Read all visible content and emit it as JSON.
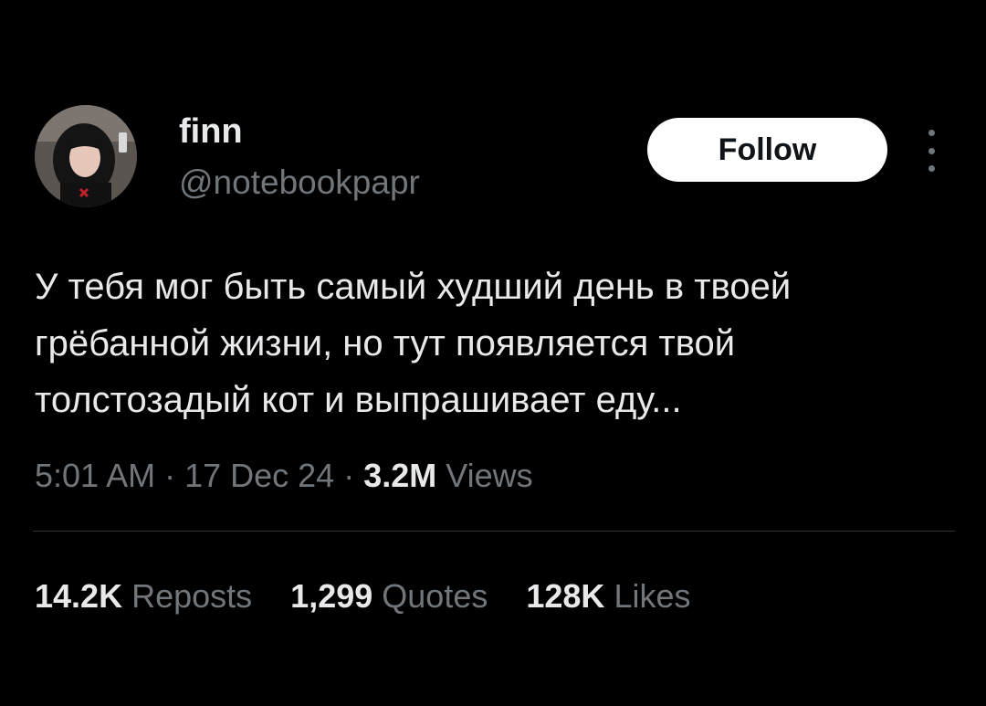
{
  "user": {
    "display_name": "finn",
    "handle": "@notebookpapr",
    "avatar": "profile-photo"
  },
  "follow_button": {
    "label": "Follow"
  },
  "more_menu": {
    "icon": "more-vertical-icon"
  },
  "tweet": {
    "lines": [
      "У тебя мог быть самый худший день в твоей",
      "грёбанной жизни, но тут появляется твой",
      "толстозадый кот и выпрашивает еду..."
    ]
  },
  "meta": {
    "time": "5:01 AM",
    "sep1": " · ",
    "date": "17 Dec 24",
    "sep2": " · ",
    "views_count": "3.2M",
    "views_label": "Views"
  },
  "stats": {
    "reposts_count": "14.2K",
    "reposts_label": "Reposts",
    "quotes_count": "1,299",
    "quotes_label": "Quotes",
    "likes_count": "128K",
    "likes_label": "Likes"
  },
  "colors": {
    "background": "#000000",
    "primary_text": "#e7e9ea",
    "secondary_text": "#71767b",
    "divider": "#2f3336",
    "follow_bg": "#ffffff"
  }
}
